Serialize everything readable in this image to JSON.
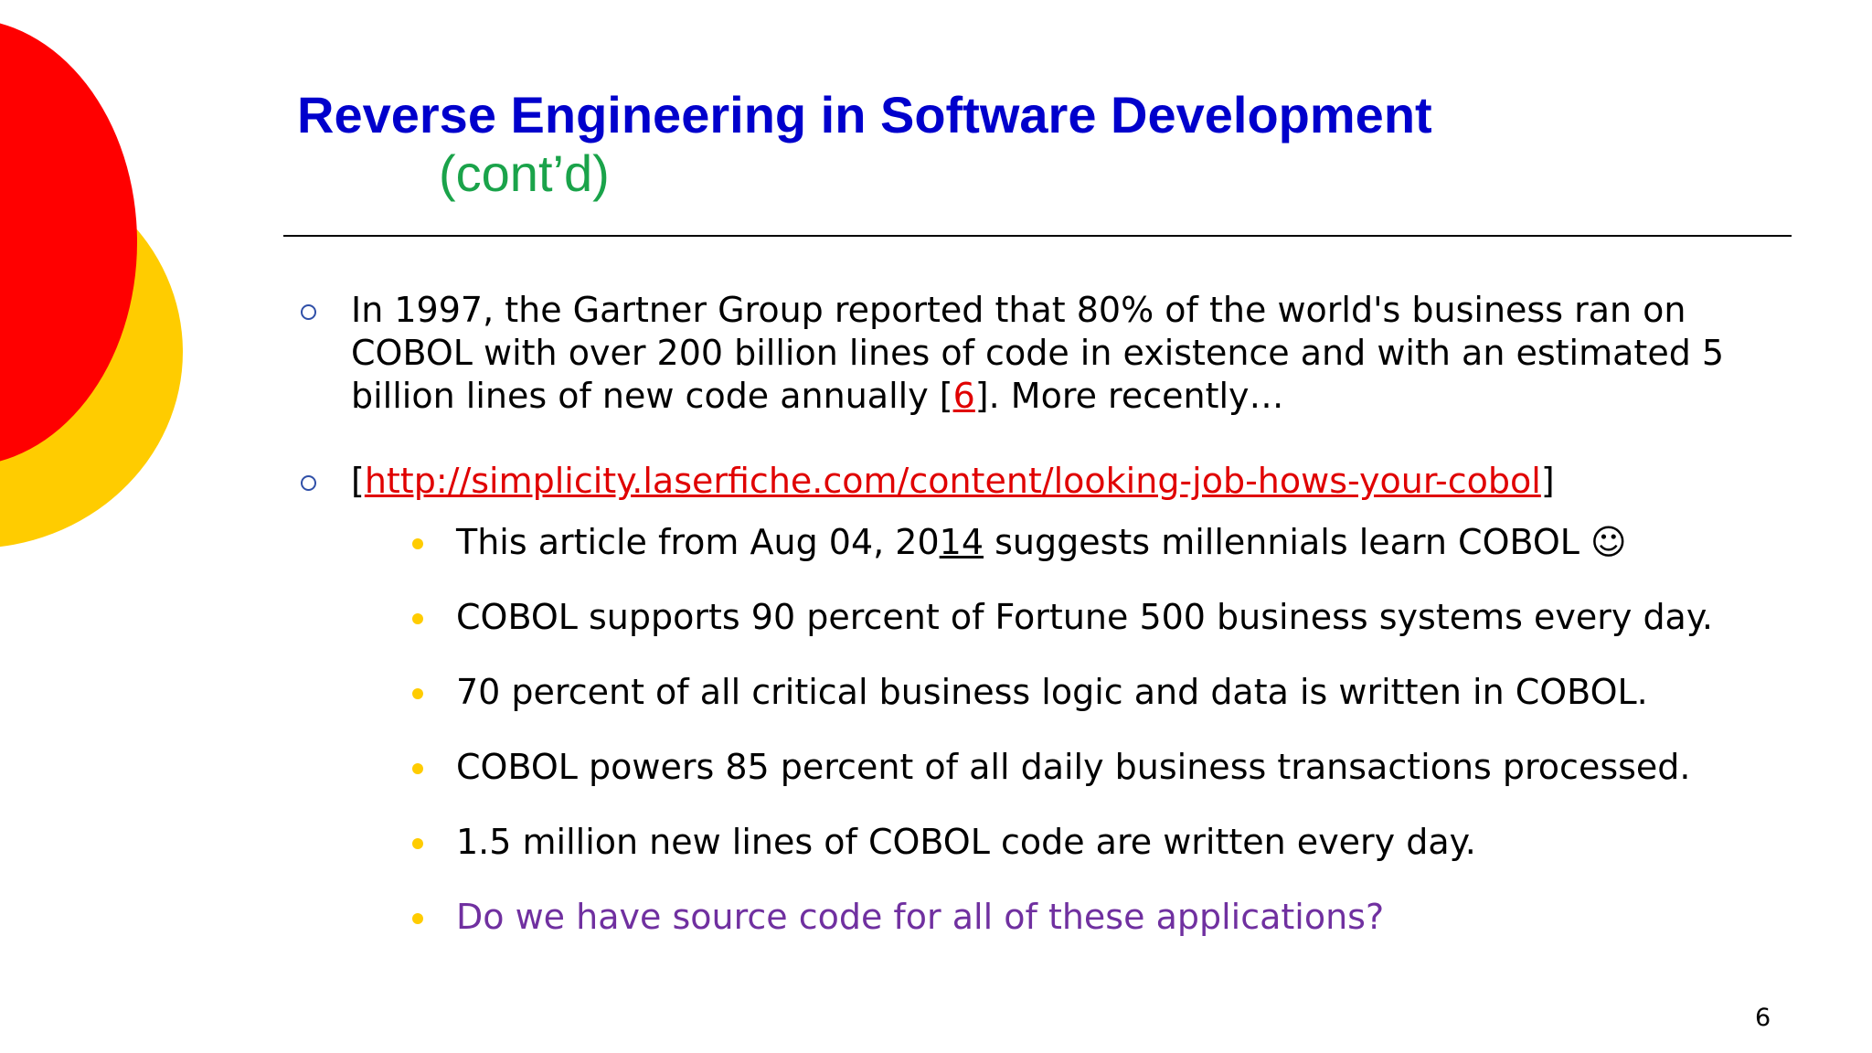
{
  "title": "Reverse Engineering in Software Development",
  "subtitle": "(cont’d)",
  "bullets": [
    {
      "text_before": "In 1997, the Gartner Group reported that 80% of the world's business ran on COBOL with over 200 billion lines of code in existence and with an estimated 5 billion lines of new code annually [",
      "ref": "6",
      "text_after": "].  More recently…"
    },
    {
      "open_bracket": "[",
      "link": "http://simplicity.laserfiche.com/content/looking-job-hows-your-cobol",
      "close_bracket": "]",
      "sub_bullets": {
        "article": {
          "before": "This article from Aug 04, 20",
          "underlined": "14",
          "after": " suggests millennials learn COBOL ☺"
        },
        "items": [
          "COBOL supports 90 percent of Fortune 500 business systems every day.",
          "70 percent of all critical business logic and data is written in COBOL.",
          "COBOL powers 85 percent of all daily business transactions processed.",
          "1.5 million new lines of COBOL code are written every day."
        ],
        "question": "Do we have source code for all of these applications?"
      }
    }
  ],
  "page_number": "6",
  "colors": {
    "title": "#0000cc",
    "subtitle": "#1aa34a",
    "link": "#e00000",
    "question": "#7030a0",
    "bullet_dot": "#ffcc00",
    "deco_red": "#ff0000",
    "deco_yellow": "#ffcc00"
  }
}
